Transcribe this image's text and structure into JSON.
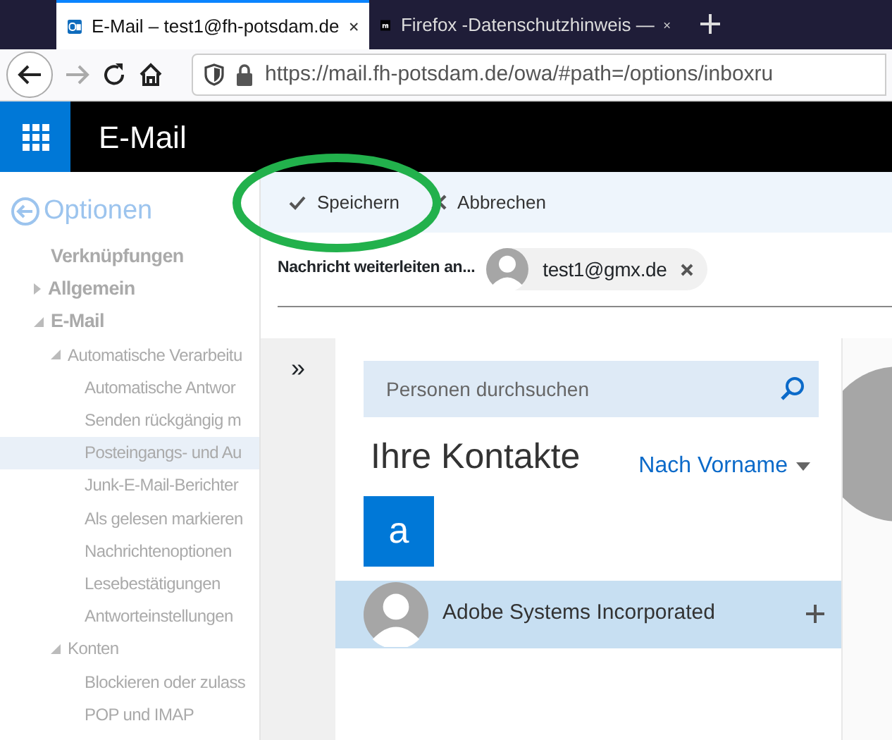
{
  "browser": {
    "tabs": [
      {
        "title": "E-Mail – test1@fh-potsdam.de",
        "selected": true
      },
      {
        "title": "Firefox -Datenschutzhinweis —",
        "selected": false
      }
    ],
    "url": "https://mail.fh-potsdam.de/owa/#path=/options/inboxru"
  },
  "app": {
    "title": "E-Mail"
  },
  "options_nav": {
    "title": "Optionen",
    "items": [
      {
        "label": "Verknüpfungen",
        "selected": false
      },
      {
        "label": "Allgemein",
        "expanded": false,
        "selected": false
      },
      {
        "label": "E-Mail",
        "expanded": true,
        "selected": false,
        "children": [
          {
            "label": "Automatische Verarbeitu",
            "expanded": true,
            "selected": false,
            "children": [
              {
                "label": "Automatische Antwor",
                "selected": false
              },
              {
                "label": "Senden rückgängig m",
                "selected": false
              },
              {
                "label": "Posteingangs- und Au",
                "selected": true
              },
              {
                "label": "Junk-E-Mail-Berichter",
                "selected": false
              },
              {
                "label": "Als gelesen markieren",
                "selected": false
              },
              {
                "label": "Nachrichtenoptionen",
                "selected": false
              },
              {
                "label": "Lesebestätigungen",
                "selected": false
              },
              {
                "label": "Antworteinstellungen",
                "selected": false
              }
            ]
          },
          {
            "label": "Konten",
            "expanded": true,
            "selected": false,
            "children": [
              {
                "label": "Blockieren oder zulass",
                "selected": false
              },
              {
                "label": "POP und IMAP",
                "selected": false
              }
            ]
          }
        ]
      }
    ]
  },
  "dialog": {
    "toolbar": [
      {
        "label": "Speichern",
        "kind": "save"
      },
      {
        "label": "Abbrechen",
        "kind": "cancel"
      }
    ],
    "forward_label": "Nachricht weiterleiten an...",
    "recipient": "test1@gmx.de",
    "picker": {
      "expand": "»",
      "search": {
        "placeholder": "Personen durchsuchen"
      },
      "heading": "Ihre Kontakte",
      "sort": "Nach Vorname",
      "groups": [
        {
          "letter": "a",
          "contacts": [
            {
              "name": "Adobe Systems Incorporated",
              "selected": true
            }
          ]
        }
      ]
    }
  }
}
